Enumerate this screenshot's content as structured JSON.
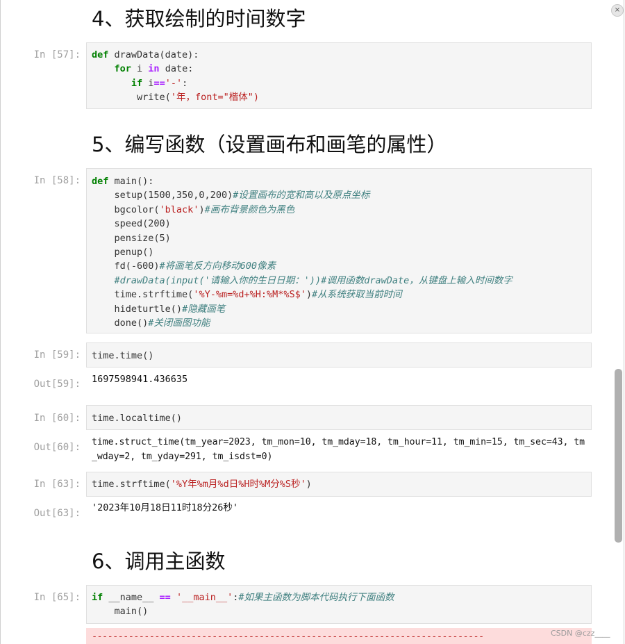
{
  "headings": {
    "h4": "4、获取绘制的时间数字",
    "h5": "5、编写函数（设置画布和画笔的属性）",
    "h6": "6、调用主函数"
  },
  "prompts": {
    "in57": "In [57]:",
    "in58": "In [58]:",
    "in59": "In [59]:",
    "out59": "Out[59]:",
    "in60": "In [60]:",
    "out60": "Out[60]:",
    "in63": "In [63]:",
    "out63": "Out[63]:",
    "in65": "In [65]:"
  },
  "cells": {
    "c57": {
      "l1_kw": "def",
      "l1_rest": " drawData(date):",
      "l2_kw": "for",
      "l2_mid": " i ",
      "l2_op": "in",
      "l2_rest": " date:",
      "l3_kw": "if",
      "l3_mid": " i",
      "l3_op": "==",
      "l3_str": "'-'",
      "l3_rest": ":",
      "l4_fn": "write(",
      "l4_str": "'年，font=\"楷体\")"
    },
    "c58": {
      "l1_kw": "def",
      "l1_rest": " main():",
      "l2_code": "setup(1500,350,0,200)",
      "l2_cm": "#设置画布的宽和高以及原点坐标",
      "l3_code": "bgcolor(",
      "l3_str": "'black'",
      "l3_close": ")",
      "l3_cm": "#画布背景颜色为黑色",
      "l4_code": "speed(200)",
      "l5_code": "pensize(5)",
      "l6_code": "penup()",
      "l7_code": "fd(-600)",
      "l7_cm": "#将画笔反方向移动600像素",
      "l8_cm": "#drawData(input('请输入你的生日日期：'))#调用函数drawDate，从键盘上输入时间数字",
      "l9_code": "time.strftime(",
      "l9_str": "'%Y-%m=%d+%H:%M*%S$'",
      "l9_close": ")",
      "l9_cm": "#从系统获取当前时间",
      "l10_code": "hideturtle()",
      "l10_cm": "#隐藏画笔",
      "l11_code": "done()",
      "l11_cm": "#关闭画图功能"
    },
    "c59": {
      "code": "time.time()",
      "output": "1697598941.436635"
    },
    "c60": {
      "code": "time.localtime()",
      "output_l1": "time.struct_time(tm_year=2023, tm_mon=10, tm_mday=18, tm_hour=11, tm_min=15, tm_sec=43, tm",
      "output_l2": "_wday=2, tm_yday=291, tm_isdst=0)"
    },
    "c63": {
      "code": "time.strftime(",
      "str": "'%Y年%m月%d日%H时%M分%S秒'",
      "close": ")",
      "output": "'2023年10月18日11时18分26秒'"
    },
    "c65": {
      "l1_kw": "if",
      "l1_mid": " __name__ ",
      "l1_op": "==",
      "l1_sp": " ",
      "l1_str": "'__main__'",
      "l1_rest": ":",
      "l1_cm": "#如果主函数为脚本代码执行下面函数",
      "l2_code": "main()"
    }
  },
  "error_dashes": "---------------------------------------------------------------------------",
  "watermark": "CSDN @czz____",
  "close_glyph": "×"
}
